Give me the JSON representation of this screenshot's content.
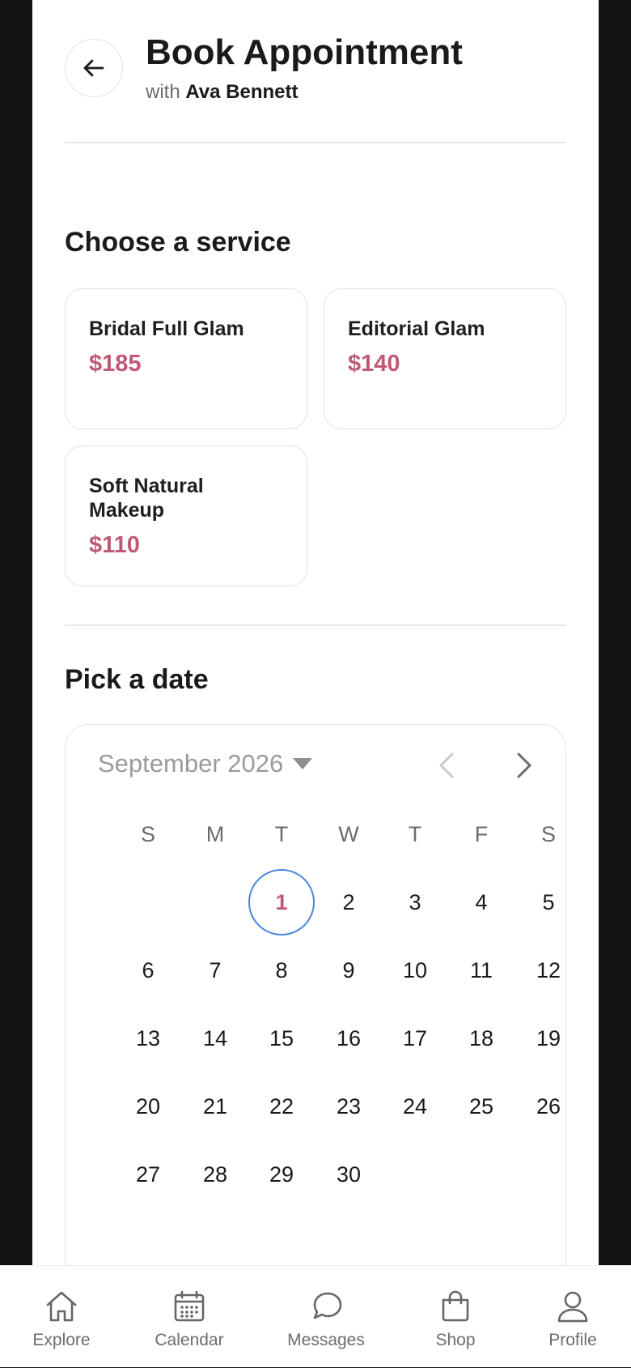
{
  "header": {
    "title": "Book Appointment",
    "subtitle_prefix": "with",
    "artist_name": "Ava Bennett"
  },
  "services": {
    "heading": "Choose a service",
    "items": [
      {
        "name": "Bridal Full Glam",
        "price": "$185"
      },
      {
        "name": "Editorial Glam",
        "price": "$140"
      },
      {
        "name": "Soft Natural Makeup",
        "price": "$110"
      }
    ]
  },
  "date_picker": {
    "heading": "Pick a date",
    "month_label": "September 2026",
    "weekdays": [
      "S",
      "M",
      "T",
      "W",
      "T",
      "F",
      "S"
    ],
    "days": [
      "1",
      "2",
      "3",
      "4",
      "5",
      "6",
      "7",
      "8",
      "9",
      "10",
      "11",
      "12",
      "13",
      "14",
      "15",
      "16",
      "17",
      "18",
      "19",
      "20",
      "21",
      "22",
      "23",
      "24",
      "25",
      "26",
      "27",
      "28",
      "29",
      "30"
    ],
    "selected_day": "1"
  },
  "tabbar": {
    "tabs": [
      {
        "label": "Explore",
        "icon": "home-icon"
      },
      {
        "label": "Calendar",
        "icon": "calendar-icon"
      },
      {
        "label": "Messages",
        "icon": "chat-icon"
      },
      {
        "label": "Shop",
        "icon": "shopping-bag-icon"
      },
      {
        "label": "Profile",
        "icon": "person-icon"
      }
    ]
  },
  "colors": {
    "accent_price": "#c05a74",
    "selected_ring": "#4a86e0",
    "background": "#ffffff",
    "frame": "#141414"
  }
}
